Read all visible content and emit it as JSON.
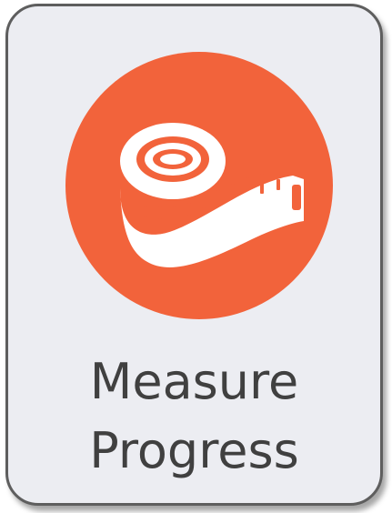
{
  "tile": {
    "icon": "measuring-tape-icon",
    "title_line1": "Measure",
    "title_line2": "Progress"
  },
  "colors": {
    "tile_background": "#ecedf2",
    "tile_border": "#5e5e5e",
    "icon_circle": "#f2633b",
    "icon_glyph": "#ffffff",
    "text": "#404040"
  }
}
